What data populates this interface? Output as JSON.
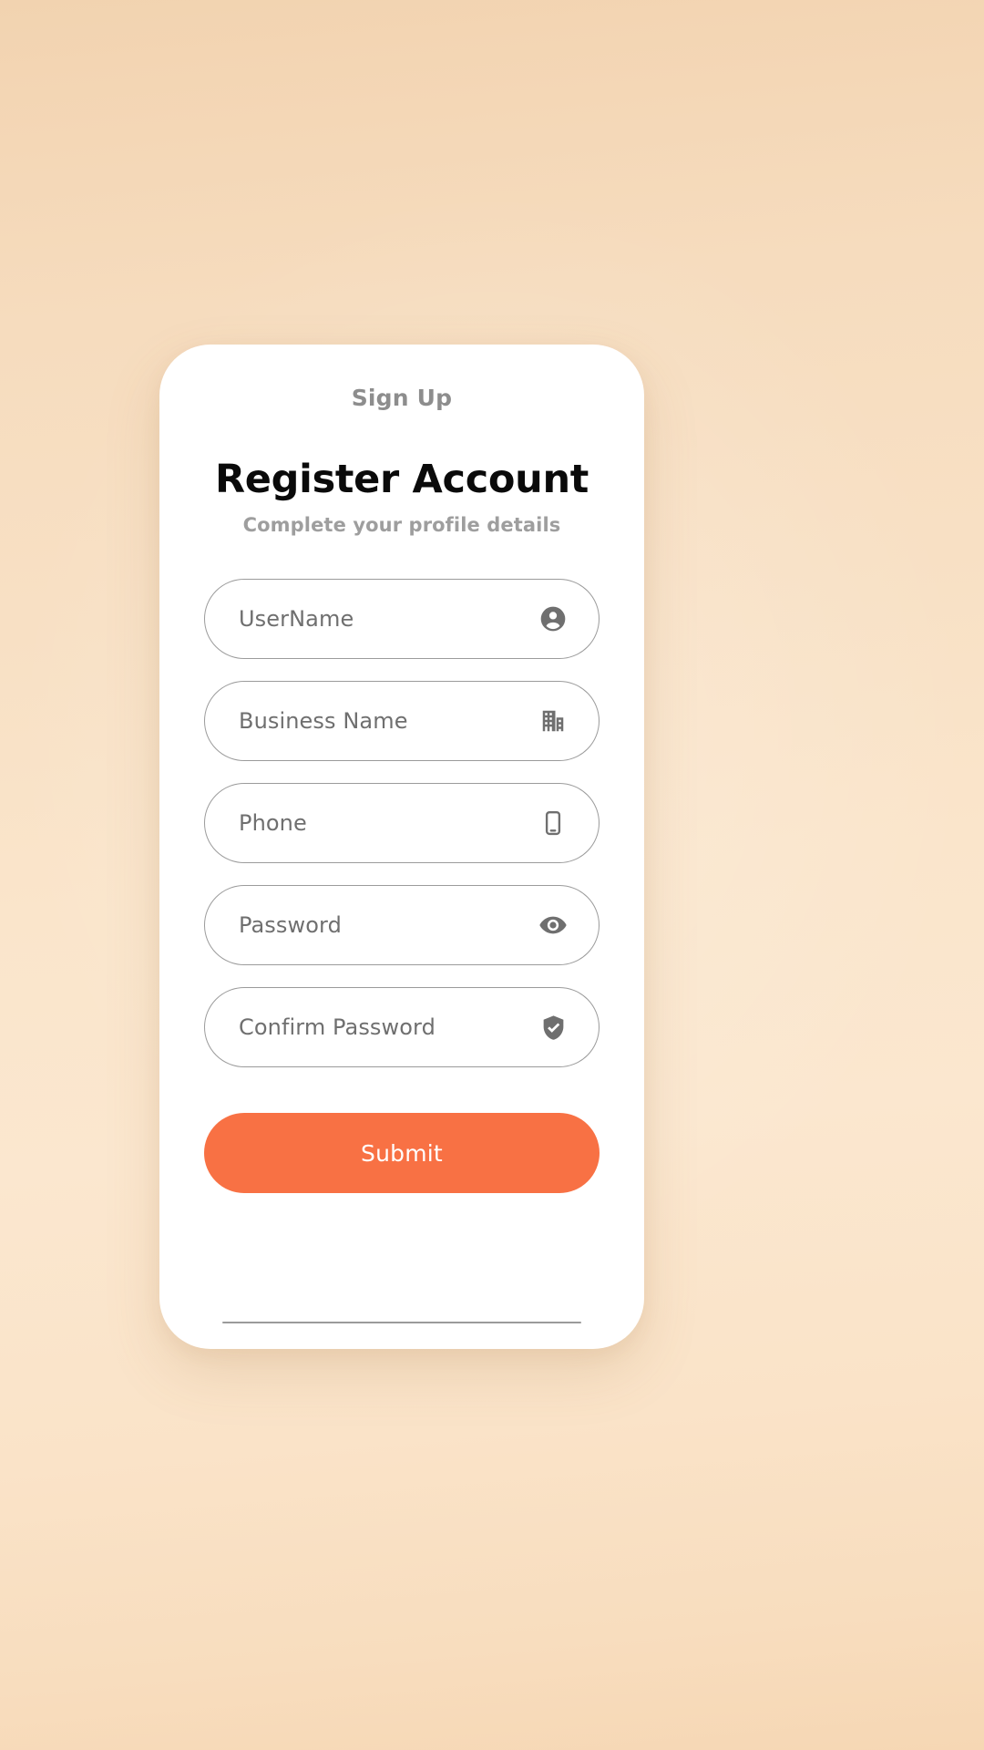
{
  "screen": {
    "name": "Register Account",
    "background_gradient_from": "#f2d3b0",
    "background_gradient_to": "#f6d7b4"
  },
  "header": {
    "eyebrow": "Sign Up",
    "title": "Register Account",
    "subtitle": "Complete your profile details"
  },
  "form": {
    "fields": [
      {
        "label": "UserName",
        "value": "",
        "placeholder": "UserName",
        "icon": "account-circle-icon"
      },
      {
        "label": "Business Name",
        "value": "",
        "placeholder": "Business Name",
        "icon": "building-icon"
      },
      {
        "label": "Phone",
        "value": "",
        "placeholder": "Phone",
        "icon": "mobile-phone-icon"
      },
      {
        "label": "Password",
        "value": "",
        "placeholder": "Password",
        "icon": "eye-icon"
      },
      {
        "label": "Confirm Password",
        "value": "",
        "placeholder": "Confirm Password",
        "icon": "shield-check-icon"
      }
    ],
    "border_color": "#9b9b9b",
    "placeholder_color": "#6f6f6f",
    "icon_color": "#6f6f6f"
  },
  "actions": {
    "submit_label": "Submit",
    "submit_color": "#f87144",
    "submit_text_color": "#ffffff"
  },
  "system": {
    "home_indicator": true
  }
}
